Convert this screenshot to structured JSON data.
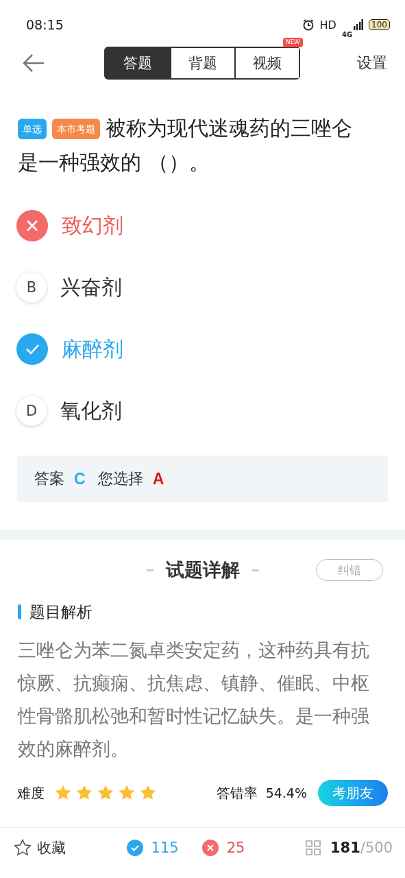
{
  "status_bar": {
    "time": "08:15",
    "hd": "HD",
    "network": "4G",
    "battery": "100"
  },
  "nav": {
    "tabs": [
      {
        "label": "答题",
        "selected": true
      },
      {
        "label": "背题",
        "selected": false
      },
      {
        "label": "视频",
        "selected": false,
        "badge": "NEW"
      }
    ],
    "settings": "设置"
  },
  "question": {
    "tags": [
      {
        "label": "单选",
        "color": "#2aa8ee"
      },
      {
        "label": "本市考题",
        "color": "#f5894a"
      }
    ],
    "text": "被称为现代迷魂药的三唑仑是一种强效的 （）。"
  },
  "options": [
    {
      "text": "致幻剂",
      "kind": "wrong"
    },
    {
      "letter": "B",
      "text": "兴奋剂",
      "kind": "normal"
    },
    {
      "text": "麻醉剂",
      "kind": "correct"
    },
    {
      "letter": "D",
      "text": "氧化剂",
      "kind": "normal"
    }
  ],
  "answer": {
    "label": "答案",
    "value": "C",
    "choice_label": "您选择",
    "choice": "A"
  },
  "detail": {
    "title": "试题详解",
    "report": "纠错",
    "section": "题目解析",
    "text": "三唑仑为苯二氮卓类安定药，这种药具有抗惊厥、抗癫痫、抗焦虑、镇静、催眠、中枢性骨骼肌松弛和暂时性记忆缺失。是一种强效的麻醉剂。",
    "difficulty_label": "难度",
    "stars": 5,
    "error_label": "答错率",
    "error_rate": "54.4%",
    "share": "考朋友"
  },
  "bottom_bar": {
    "favorite": "收藏",
    "correct": "115",
    "wrong": "25",
    "current": "181",
    "total": "/500"
  }
}
